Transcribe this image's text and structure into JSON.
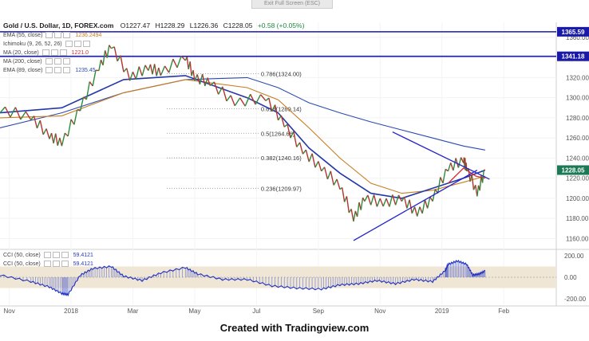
{
  "toolbar": {
    "exit_label": "Exit Full Screen (ESC)"
  },
  "header": {
    "symbol": "Gold / U.S. Dollar, 1D, FOREX.com",
    "open": "O1227.47",
    "high": "H1228.29",
    "low": "L1226.36",
    "close": "C1228.05",
    "change": "+0.58 (+0.05%)"
  },
  "indicators": [
    {
      "label": "EMA (55, close)",
      "value": "1236.2494",
      "color": "#c87d1e"
    },
    {
      "label": "Ichimoku (9, 26, 52, 26)",
      "value": "",
      "color": "#7a7a7a"
    },
    {
      "label": "MA (20, close)",
      "value": "1221.0",
      "color": "#d43030"
    },
    {
      "label": "MA (200, close)",
      "value": "",
      "color": "#8a5a2a"
    },
    {
      "label": "EMA (89, close)",
      "value": "1235.45",
      "color": "#2a4ab0"
    }
  ],
  "cci_legend": [
    {
      "label": "CCI (50, close)",
      "value": "59.4121"
    },
    {
      "label": "CCI (50, close)",
      "value": "59.4121"
    }
  ],
  "footer": {
    "text": "Created with Tradingview.com"
  },
  "chart_data": {
    "type": "line",
    "title": "Gold / U.S. Dollar, 1D, FOREX.com",
    "price_axis": {
      "range": [
        1150,
        1375
      ],
      "ticks": [
        1160,
        1180,
        1200,
        1220,
        1240,
        1260,
        1280,
        1300,
        1320,
        1340,
        1360
      ]
    },
    "time_axis": {
      "labels": [
        "Nov",
        "2018",
        "Mar",
        "May",
        "Jul",
        "Sep",
        "Nov",
        "2019",
        "Feb"
      ]
    },
    "last_price": 1228.05,
    "price_markers": [
      {
        "value": 1365.59,
        "label": "1365.59",
        "color": "#1a1aa8"
      },
      {
        "value": 1341.18,
        "label": "1341.18",
        "color": "#1a1aa8"
      },
      {
        "value": 1228.05,
        "label": "1228.05",
        "color": "#1b7a55"
      }
    ],
    "fib_levels": [
      {
        "ratio_label": "0.786(1324.00)",
        "value": 1324.0
      },
      {
        "ratio_label": "0.618(1289.14)",
        "value": 1289.14
      },
      {
        "ratio_label": "0.5(1264.66)",
        "value": 1264.66
      },
      {
        "ratio_label": "0.382(1240.16)",
        "value": 1240.16
      },
      {
        "ratio_label": "0.236(1209.97)",
        "value": 1209.97
      }
    ],
    "triangle": {
      "upper": [
        {
          "t": 6.35,
          "p": 1266
        },
        {
          "t": 7.92,
          "p": 1219
        }
      ],
      "lower": [
        {
          "t": 5.72,
          "p": 1158
        },
        {
          "t": 7.72,
          "p": 1228
        }
      ]
    },
    "price_series": {
      "name": "XAUUSD",
      "points": [
        [
          0,
          1288
        ],
        [
          0.5,
          1281
        ],
        [
          0.8,
          1262
        ],
        [
          1.0,
          1255
        ],
        [
          1.3,
          1290
        ],
        [
          1.6,
          1330
        ],
        [
          1.8,
          1352
        ],
        [
          2.1,
          1320
        ],
        [
          2.4,
          1330
        ],
        [
          2.6,
          1325
        ],
        [
          3.0,
          1340
        ],
        [
          3.15,
          1320
        ],
        [
          3.4,
          1315
        ],
        [
          3.8,
          1295
        ],
        [
          4.3,
          1300
        ],
        [
          4.6,
          1274
        ],
        [
          4.9,
          1247
        ],
        [
          5.2,
          1230
        ],
        [
          5.5,
          1212
        ],
        [
          5.72,
          1180
        ],
        [
          5.9,
          1200
        ],
        [
          6.2,
          1195
        ],
        [
          6.5,
          1200
        ],
        [
          6.75,
          1185
        ],
        [
          7.0,
          1200
        ],
        [
          7.25,
          1230
        ],
        [
          7.5,
          1238
        ],
        [
          7.55,
          1230
        ],
        [
          7.72,
          1205
        ],
        [
          7.85,
          1228
        ]
      ]
    },
    "ema55": {
      "points": [
        [
          0,
          1285
        ],
        [
          1.0,
          1290
        ],
        [
          2.0,
          1318
        ],
        [
          3.0,
          1322
        ],
        [
          4.0,
          1300
        ],
        [
          4.5,
          1285
        ],
        [
          5.0,
          1250
        ],
        [
          5.5,
          1225
        ],
        [
          6.0,
          1205
        ],
        [
          6.5,
          1200
        ],
        [
          7.0,
          1210
        ],
        [
          7.5,
          1220
        ],
        [
          7.85,
          1228
        ]
      ],
      "color": "#2438a8"
    },
    "ema89": {
      "points": [
        [
          0,
          1280
        ],
        [
          1.0,
          1282
        ],
        [
          2.0,
          1305
        ],
        [
          3.0,
          1318
        ],
        [
          4.0,
          1310
        ],
        [
          4.5,
          1298
        ],
        [
          5.0,
          1270
        ],
        [
          5.5,
          1240
        ],
        [
          6.0,
          1215
        ],
        [
          6.5,
          1205
        ],
        [
          7.0,
          1208
        ],
        [
          7.5,
          1216
        ],
        [
          7.85,
          1222
        ]
      ],
      "color": "#c87d1e"
    },
    "ma200": {
      "points": [
        [
          0,
          1270
        ],
        [
          1.0,
          1285
        ],
        [
          2.0,
          1305
        ],
        [
          3.0,
          1318
        ],
        [
          4.0,
          1320
        ],
        [
          4.5,
          1310
        ],
        [
          5.0,
          1295
        ],
        [
          5.5,
          1285
        ],
        [
          6.0,
          1276
        ],
        [
          6.5,
          1268
        ],
        [
          7.0,
          1260
        ],
        [
          7.5,
          1252
        ],
        [
          7.85,
          1248
        ]
      ],
      "color": "#2a4ab0"
    },
    "ma20": {
      "points": [
        [
          7.25,
          1215
        ],
        [
          7.5,
          1230
        ],
        [
          7.7,
          1222
        ],
        [
          7.85,
          1220
        ]
      ],
      "color": "#d43030"
    },
    "cci": {
      "name": "CCI (50, close)",
      "range": [
        -250,
        250
      ],
      "ticks": [
        200,
        0,
        -200
      ],
      "band": [
        -100,
        100
      ],
      "last": 59.4121,
      "points": [
        [
          0,
          20
        ],
        [
          0.5,
          -40
        ],
        [
          0.8,
          -90
        ],
        [
          1.0,
          -150
        ],
        [
          1.1,
          -160
        ],
        [
          1.3,
          20
        ],
        [
          1.5,
          80
        ],
        [
          1.8,
          100
        ],
        [
          2.0,
          10
        ],
        [
          2.3,
          -30
        ],
        [
          2.6,
          40
        ],
        [
          3.0,
          90
        ],
        [
          3.2,
          30
        ],
        [
          3.6,
          -20
        ],
        [
          4.0,
          -20
        ],
        [
          4.4,
          -80
        ],
        [
          4.8,
          -100
        ],
        [
          5.2,
          -110
        ],
        [
          5.5,
          -70
        ],
        [
          5.8,
          -60
        ],
        [
          6.1,
          -30
        ],
        [
          6.4,
          -60
        ],
        [
          6.7,
          -20
        ],
        [
          7.0,
          -40
        ],
        [
          7.2,
          60
        ],
        [
          7.25,
          120
        ],
        [
          7.4,
          150
        ],
        [
          7.55,
          120
        ],
        [
          7.65,
          20
        ],
        [
          7.75,
          30
        ],
        [
          7.85,
          59
        ]
      ]
    }
  }
}
